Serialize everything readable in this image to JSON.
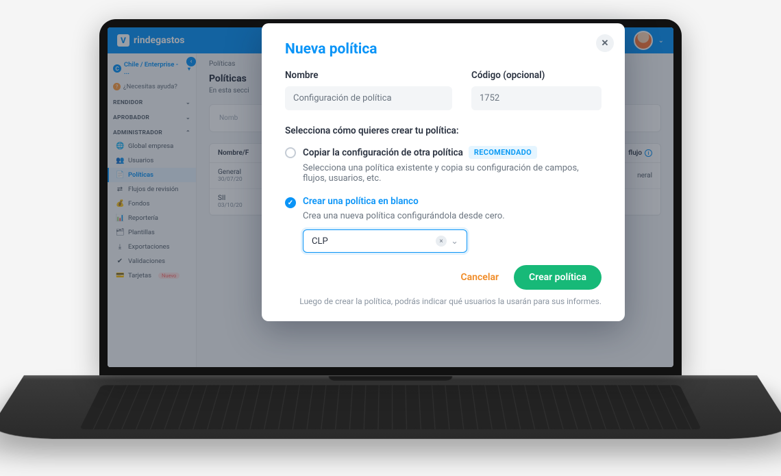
{
  "app": {
    "brand": "rindegastos",
    "logo_letter": "V"
  },
  "sidebar": {
    "context_badge": "C",
    "context": "Chile / Enterprise - ...",
    "help": "¿Necesitas ayuda?",
    "sections": [
      {
        "label": "RENDIDOR"
      },
      {
        "label": "APROBADOR"
      },
      {
        "label": "ADMINISTRADOR"
      }
    ],
    "admin_items": [
      {
        "icon": "🌐",
        "label": "Global empresa"
      },
      {
        "icon": "👥",
        "label": "Usuarios"
      },
      {
        "icon": "📄",
        "label": "Políticas",
        "active": true
      },
      {
        "icon": "⇄",
        "label": "Flujos de revisión"
      },
      {
        "icon": "💰",
        "label": "Fondos"
      },
      {
        "icon": "📊",
        "label": "Reportería"
      },
      {
        "icon": "🗂",
        "label": "Plantillas"
      },
      {
        "icon": "⤓",
        "label": "Exportaciones"
      },
      {
        "icon": "✔",
        "label": "Validaciones"
      },
      {
        "icon": "💳",
        "label": "Tarjetas",
        "badge": "Nuevo"
      }
    ]
  },
  "main": {
    "breadcrumb": "Políticas",
    "title": "Políticas",
    "subtitle": "En esta secci",
    "filter_placeholder": "Nomb",
    "table": {
      "headers": {
        "name": "Nombre/F",
        "flow": "flujo"
      },
      "rows": [
        {
          "name": "General",
          "date": "30/07/20",
          "flow": "neral"
        },
        {
          "name": "SII",
          "date": "03/10/20",
          "flow": ""
        }
      ]
    }
  },
  "modal": {
    "title": "Nueva política",
    "name_label": "Nombre",
    "name_value": "Configuración de política",
    "code_label": "Código (opcional)",
    "code_value": "1752",
    "select_label": "Selecciona cómo quieres crear tu política:",
    "option_copy": {
      "title": "Copiar la configuración de otra política",
      "badge": "RECOMENDADO",
      "desc": "Selecciona una política existente y copia su configuración de campos, flujos, usuarios, etc."
    },
    "option_blank": {
      "title": "Crear una política en blanco",
      "desc": "Crea una nueva política configurándola desde cero.",
      "currency": "CLP"
    },
    "cancel": "Cancelar",
    "submit": "Crear política",
    "footnote": "Luego de crear la política, podrás indicar qué usuarios la usarán para sus informes."
  }
}
